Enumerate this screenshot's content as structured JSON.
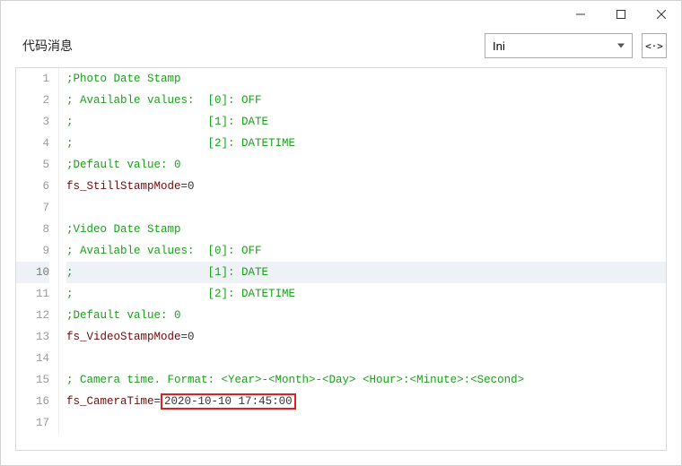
{
  "window": {
    "title": "代码消息"
  },
  "toolbar": {
    "language_selected": "Ini",
    "code_toggle_label": "<·>"
  },
  "code": {
    "active_line": 10,
    "highlight": {
      "line": 16,
      "text": "2020-10-10 17:45:00"
    },
    "lines": [
      {
        "n": 1,
        "tokens": [
          {
            "t": "comment",
            "v": ";Photo Date Stamp"
          }
        ]
      },
      {
        "n": 2,
        "tokens": [
          {
            "t": "comment",
            "v": "; Available values:  [0]: OFF"
          }
        ]
      },
      {
        "n": 3,
        "tokens": [
          {
            "t": "comment",
            "v": ";                    [1]: DATE"
          }
        ]
      },
      {
        "n": 4,
        "tokens": [
          {
            "t": "comment",
            "v": ";                    [2]: DATETIME"
          }
        ]
      },
      {
        "n": 5,
        "tokens": [
          {
            "t": "comment",
            "v": ";Default value: 0"
          }
        ]
      },
      {
        "n": 6,
        "tokens": [
          {
            "t": "key",
            "v": "fs_StillStampMode"
          },
          {
            "t": "op",
            "v": "="
          },
          {
            "t": "value",
            "v": "0"
          }
        ]
      },
      {
        "n": 7,
        "tokens": []
      },
      {
        "n": 8,
        "tokens": [
          {
            "t": "comment",
            "v": ";Video Date Stamp"
          }
        ]
      },
      {
        "n": 9,
        "tokens": [
          {
            "t": "comment",
            "v": "; Available values:  [0]: OFF"
          }
        ]
      },
      {
        "n": 10,
        "tokens": [
          {
            "t": "comment",
            "v": ";                    [1]: DATE"
          }
        ]
      },
      {
        "n": 11,
        "tokens": [
          {
            "t": "comment",
            "v": ";                    [2]: DATETIME"
          }
        ]
      },
      {
        "n": 12,
        "tokens": [
          {
            "t": "comment",
            "v": ";Default value: 0"
          }
        ]
      },
      {
        "n": 13,
        "tokens": [
          {
            "t": "key",
            "v": "fs_VideoStampMode"
          },
          {
            "t": "op",
            "v": "="
          },
          {
            "t": "value",
            "v": "0"
          }
        ]
      },
      {
        "n": 14,
        "tokens": []
      },
      {
        "n": 15,
        "tokens": [
          {
            "t": "comment",
            "v": "; Camera time. Format: <Year>-<Month>-<Day> <Hour>:<Minute>:<Second>"
          }
        ]
      },
      {
        "n": 16,
        "tokens": [
          {
            "t": "key",
            "v": "fs_CameraTime"
          },
          {
            "t": "op",
            "v": "="
          },
          {
            "t": "value",
            "v": "2020-10-10 17:45:00",
            "boxed": true
          }
        ]
      },
      {
        "n": 17,
        "tokens": []
      }
    ]
  }
}
